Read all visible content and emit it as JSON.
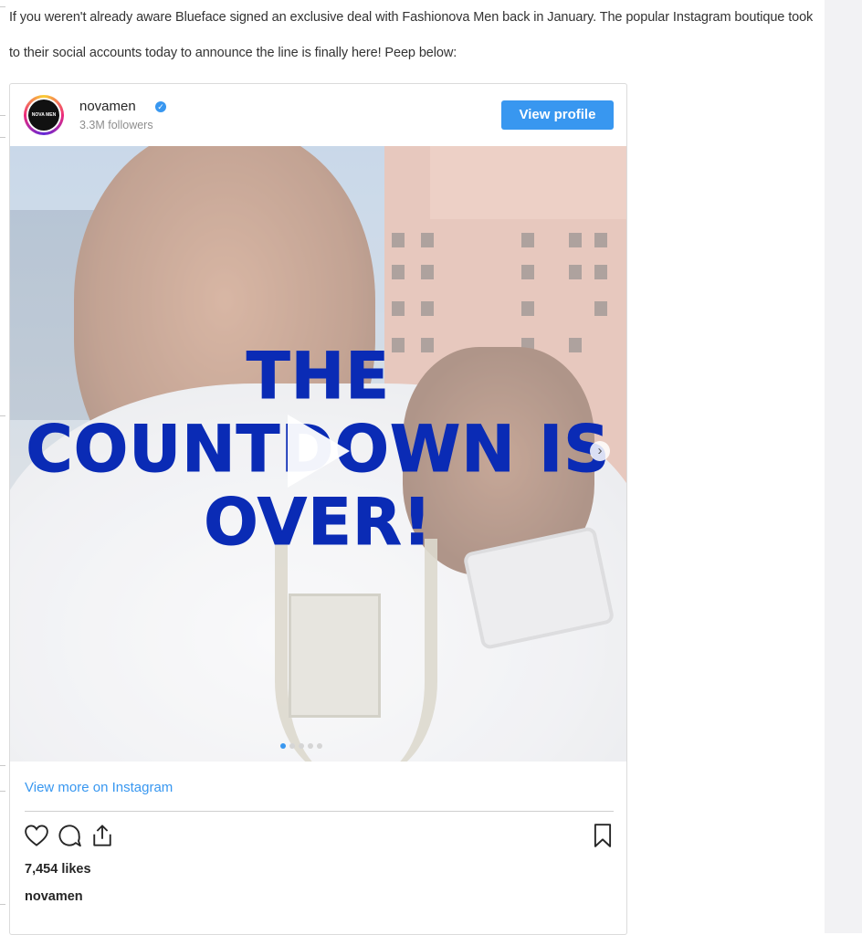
{
  "article": {
    "intro_text": "If you weren't already aware Blueface signed an exclusive deal with Fashionova Men back in January. The popular Instagram boutique took to their social accounts today to announce the line is finally here! Peep below:"
  },
  "instagram_embed": {
    "avatar_text": "NOVA MEN",
    "username": "novamen",
    "verified_icon": "verified-check-icon",
    "followers": "3.3M followers",
    "view_profile_label": "View profile",
    "media": {
      "headline": "THE COUNTDOWN IS OVER!",
      "play_icon": "play-icon",
      "next_icon": "chevron-right-icon",
      "carousel_dots": 5
    },
    "view_more_label": "View more on Instagram",
    "actions": [
      "heart-icon",
      "comment-icon",
      "share-icon",
      "bookmark-icon"
    ],
    "likes": "7,454 likes",
    "caption_username": "novamen",
    "colors": {
      "accent": "#3897f0",
      "headline": "#0a2bb5"
    }
  }
}
